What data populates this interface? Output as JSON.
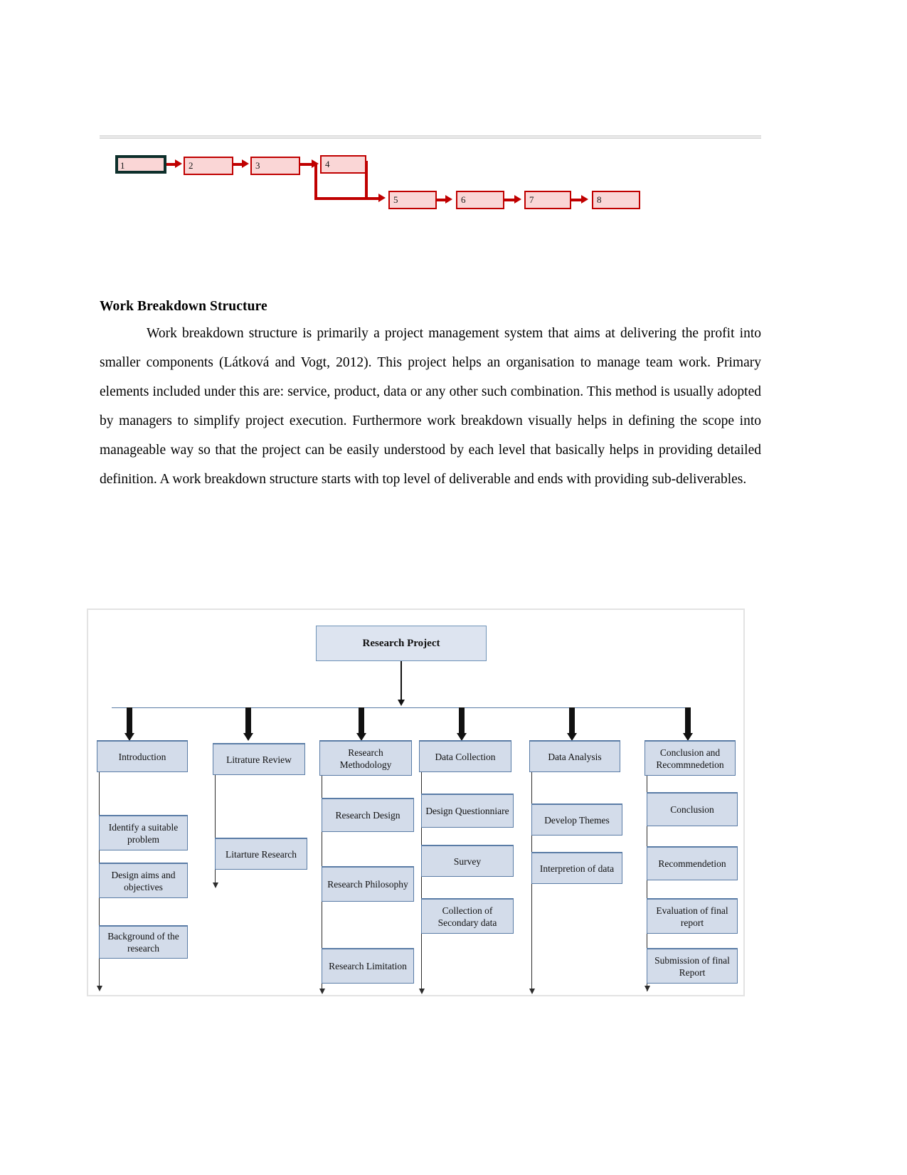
{
  "network_diagram": {
    "name": "project-network-diagram",
    "node_fill": "#fad6d6",
    "node_border": "#c00000",
    "selected_border": "#0d2f2b",
    "nodes": [
      {
        "label": "1",
        "selected": true
      },
      {
        "label": "2",
        "selected": false
      },
      {
        "label": "3",
        "selected": false
      },
      {
        "label": "4",
        "selected": false
      },
      {
        "label": "5",
        "selected": false
      },
      {
        "label": "6",
        "selected": false
      },
      {
        "label": "7",
        "selected": false
      },
      {
        "label": "8",
        "selected": false
      }
    ]
  },
  "section": {
    "heading": "Work Breakdown Structure",
    "paragraph": "Work breakdown structure is primarily a project management system that aims at delivering the profit into smaller components (Látková and Vogt, 2012). This project helps an organisation to manage team work. Primary elements included under this are: service, product, data or any other such combination. This method is usually adopted by managers to simplify project execution. Furthermore work breakdown visually helps in defining the scope into manageable way so that the project can be easily understood by each level that basically helps in providing detailed definition. A work breakdown structure starts with top level of deliverable and ends with providing sub-deliverables."
  },
  "wbs_chart": {
    "name": "work-breakdown-structure-chart",
    "box_fill": "#d3dcea",
    "box_border": "#5a7ca6",
    "root": {
      "label": "Research Project"
    },
    "branches": [
      {
        "label": "Introduction",
        "children": [
          "Identify a suitable problem",
          "Design aims and objectives",
          "Background of the research"
        ]
      },
      {
        "label": "Litrature Review",
        "children": [
          "Litarture Research"
        ]
      },
      {
        "label": "Research Methodology",
        "children": [
          "Research Design",
          "Research Philosophy",
          "Research Limitation"
        ]
      },
      {
        "label": "Data Collection",
        "children": [
          "Design Questionniare",
          "Survey",
          "Collection of Secondary data"
        ]
      },
      {
        "label": "Data Analysis",
        "children": [
          "Develop Themes",
          "Interpretion of data"
        ]
      },
      {
        "label": "Conclusion and Recommnedetion",
        "children": [
          "Conclusion",
          "Recommendetion",
          "Evaluation of final report",
          "Submission of final Report"
        ]
      }
    ]
  }
}
